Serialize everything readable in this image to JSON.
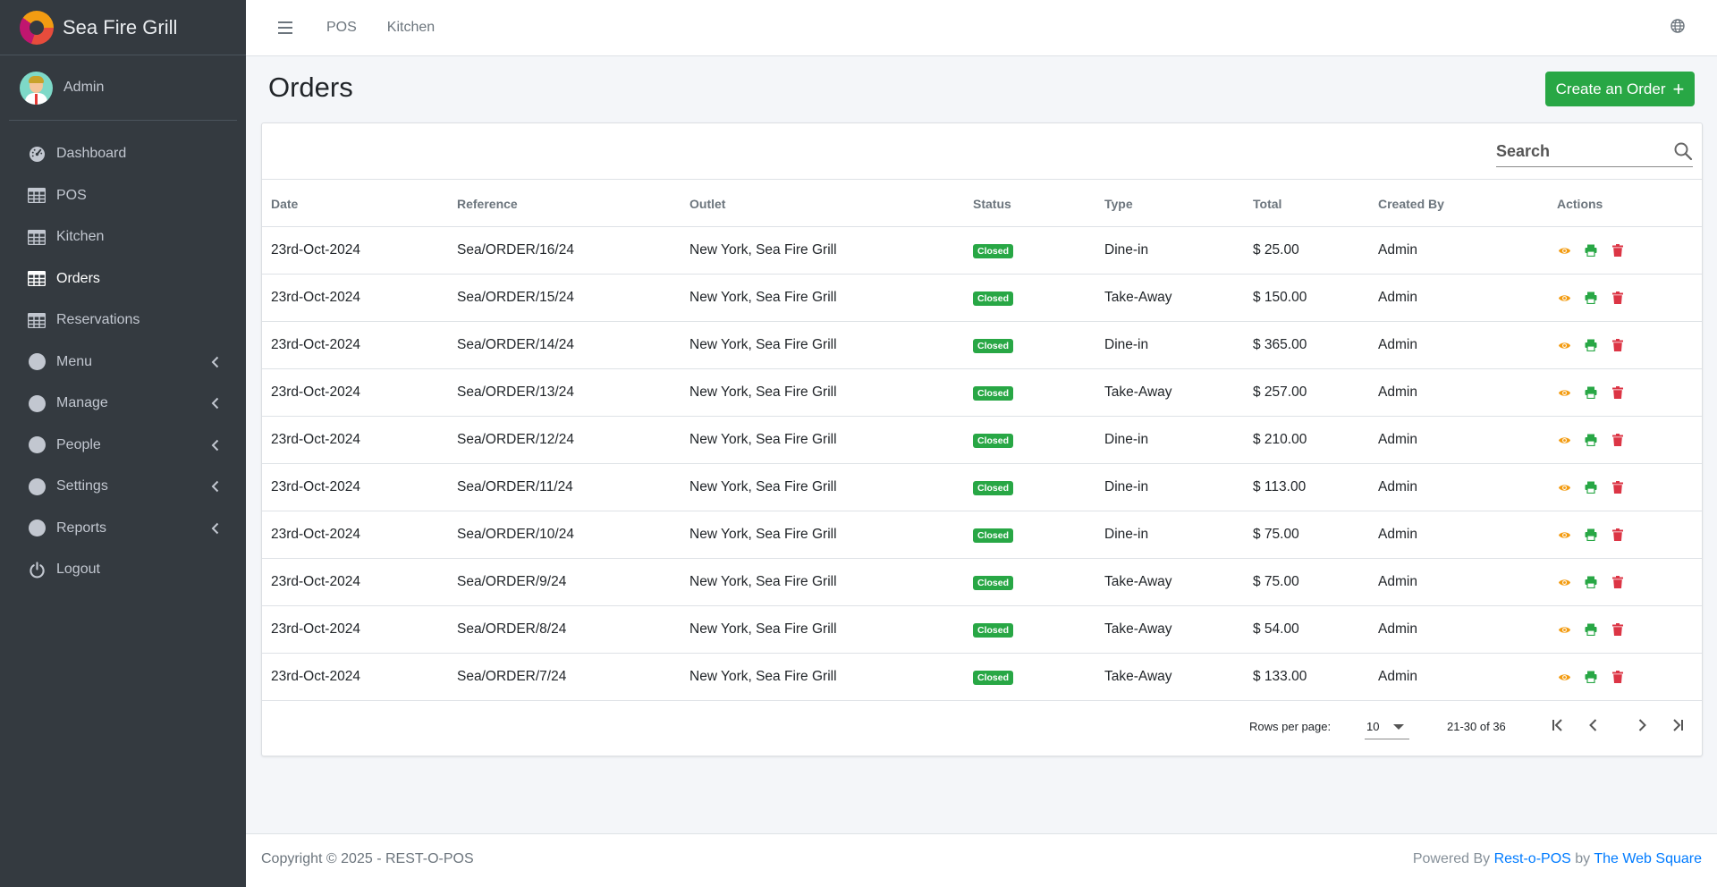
{
  "brand": {
    "name": "Sea Fire Grill"
  },
  "user": {
    "name": "Admin"
  },
  "sidebar": {
    "items": [
      {
        "label": "Dashboard"
      },
      {
        "label": "POS"
      },
      {
        "label": "Kitchen"
      },
      {
        "label": "Orders",
        "active": true
      },
      {
        "label": "Reservations"
      },
      {
        "label": "Menu"
      },
      {
        "label": "Manage"
      },
      {
        "label": "People"
      },
      {
        "label": "Settings"
      },
      {
        "label": "Reports"
      },
      {
        "label": "Logout"
      }
    ]
  },
  "topbar": {
    "links": [
      "POS",
      "Kitchen"
    ]
  },
  "page": {
    "title": "Orders",
    "create_button": "Create an Order",
    "create_icon": "+"
  },
  "search": {
    "placeholder": "Search"
  },
  "table": {
    "columns": [
      "Date",
      "Reference",
      "Outlet",
      "Status",
      "Type",
      "Total",
      "Created By",
      "Actions"
    ],
    "rows": [
      {
        "date": "23rd-Oct-2024",
        "reference": "Sea/ORDER/16/24",
        "outlet": "New York, Sea Fire Grill",
        "status": "Closed",
        "type": "Dine-in",
        "total": "$ 25.00",
        "created_by": "Admin"
      },
      {
        "date": "23rd-Oct-2024",
        "reference": "Sea/ORDER/15/24",
        "outlet": "New York, Sea Fire Grill",
        "status": "Closed",
        "type": "Take-Away",
        "total": "$ 150.00",
        "created_by": "Admin"
      },
      {
        "date": "23rd-Oct-2024",
        "reference": "Sea/ORDER/14/24",
        "outlet": "New York, Sea Fire Grill",
        "status": "Closed",
        "type": "Dine-in",
        "total": "$ 365.00",
        "created_by": "Admin"
      },
      {
        "date": "23rd-Oct-2024",
        "reference": "Sea/ORDER/13/24",
        "outlet": "New York, Sea Fire Grill",
        "status": "Closed",
        "type": "Take-Away",
        "total": "$ 257.00",
        "created_by": "Admin"
      },
      {
        "date": "23rd-Oct-2024",
        "reference": "Sea/ORDER/12/24",
        "outlet": "New York, Sea Fire Grill",
        "status": "Closed",
        "type": "Dine-in",
        "total": "$ 210.00",
        "created_by": "Admin"
      },
      {
        "date": "23rd-Oct-2024",
        "reference": "Sea/ORDER/11/24",
        "outlet": "New York, Sea Fire Grill",
        "status": "Closed",
        "type": "Dine-in",
        "total": "$ 113.00",
        "created_by": "Admin"
      },
      {
        "date": "23rd-Oct-2024",
        "reference": "Sea/ORDER/10/24",
        "outlet": "New York, Sea Fire Grill",
        "status": "Closed",
        "type": "Dine-in",
        "total": "$ 75.00",
        "created_by": "Admin"
      },
      {
        "date": "23rd-Oct-2024",
        "reference": "Sea/ORDER/9/24",
        "outlet": "New York, Sea Fire Grill",
        "status": "Closed",
        "type": "Take-Away",
        "total": "$ 75.00",
        "created_by": "Admin"
      },
      {
        "date": "23rd-Oct-2024",
        "reference": "Sea/ORDER/8/24",
        "outlet": "New York, Sea Fire Grill",
        "status": "Closed",
        "type": "Take-Away",
        "total": "$ 54.00",
        "created_by": "Admin"
      },
      {
        "date": "23rd-Oct-2024",
        "reference": "Sea/ORDER/7/24",
        "outlet": "New York, Sea Fire Grill",
        "status": "Closed",
        "type": "Take-Away",
        "total": "$ 133.00",
        "created_by": "Admin"
      }
    ]
  },
  "pagination": {
    "rows_label": "Rows per page:",
    "rows_value": "10",
    "range": "21-30 of 36"
  },
  "footer": {
    "copyright": "Copyright © 2025 - REST-O-POS",
    "powered_prefix": "Powered By",
    "powered_link": "Rest-o-POS",
    "powered_by": "by",
    "company_link": "The Web Square"
  },
  "colors": {
    "sidebar": "#343a40",
    "accent_green": "#28a745",
    "view_icon": "#f39c12",
    "print_icon": "#28a745",
    "delete_icon": "#dc3545",
    "link": "#007bff"
  },
  "icons": [
    "dashboard-icon",
    "grid-icon",
    "circle-icon",
    "logout-icon",
    "chevron-left-icon",
    "hamburger-icon",
    "globe-icon",
    "search-icon",
    "eye-icon",
    "print-icon",
    "trash-icon",
    "first-page-icon",
    "prev-page-icon",
    "next-page-icon",
    "last-page-icon"
  ]
}
